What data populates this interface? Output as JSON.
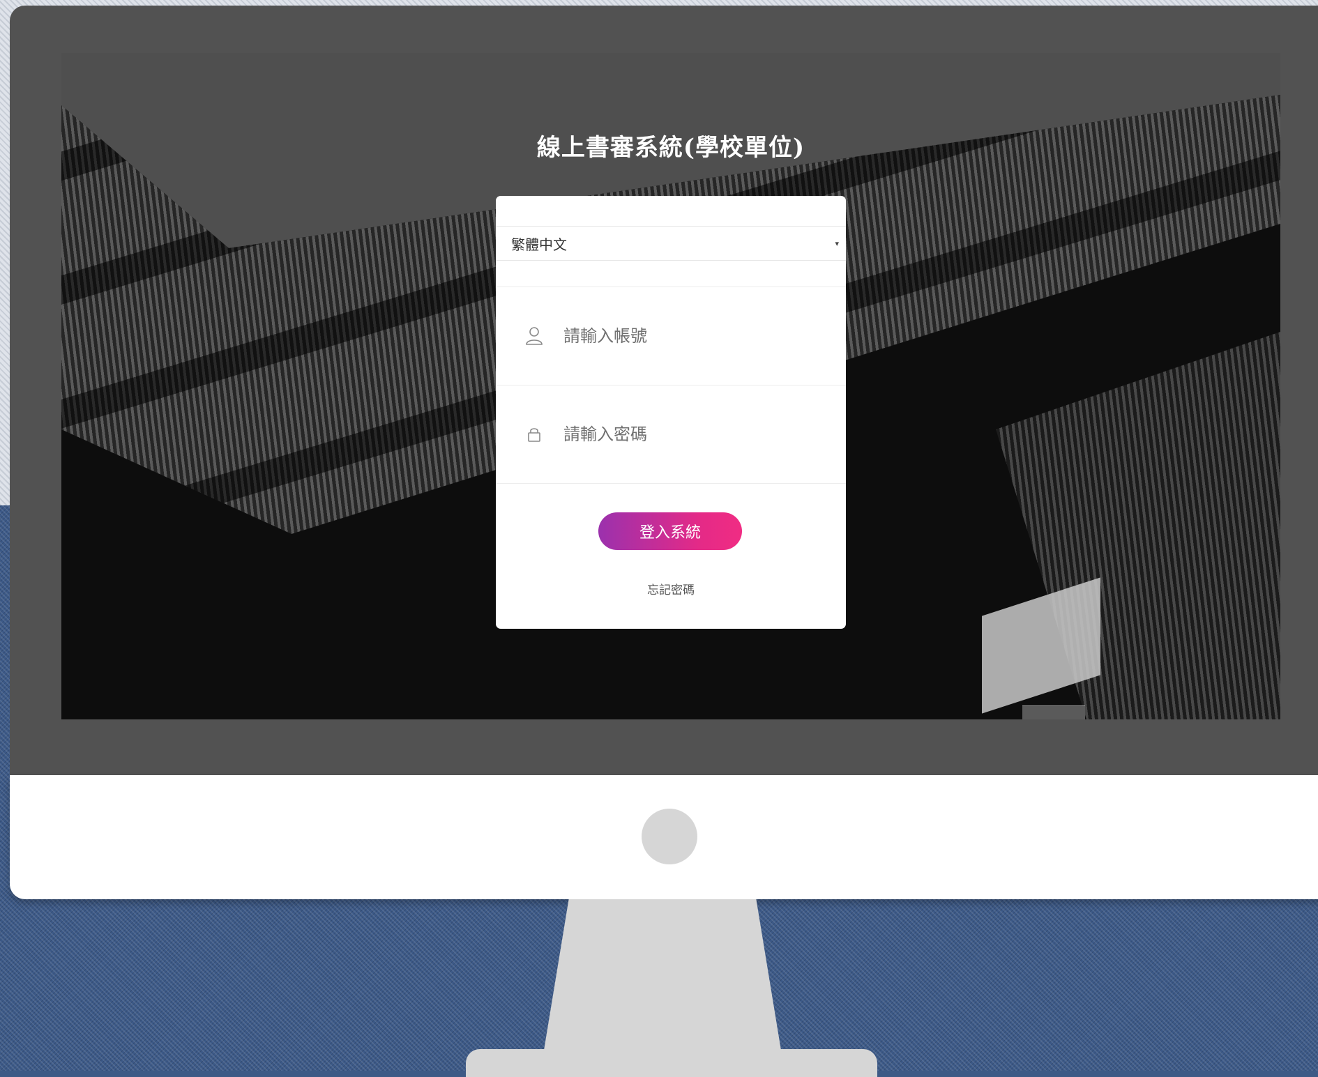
{
  "app": {
    "title": "線上書審系統(學校單位)"
  },
  "login": {
    "language_select": {
      "value": "繁體中文",
      "caret": "▾"
    },
    "username": {
      "placeholder": "請輸入帳號",
      "value": ""
    },
    "password": {
      "placeholder": "請輸入密碼",
      "value": ""
    },
    "submit_label": "登入系統",
    "forgot_label": "忘記密碼"
  },
  "icons": {
    "username": "user-icon",
    "password": "lock-icon"
  },
  "colors": {
    "button_gradient_start": "#9b31ad",
    "button_gradient_end": "#f02c83",
    "card_background": "#ffffff",
    "bezel": "#525252"
  }
}
